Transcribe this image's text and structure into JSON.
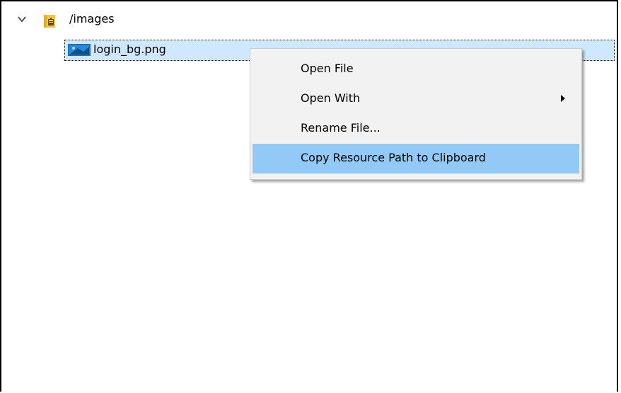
{
  "tree": {
    "folder": {
      "label": "/images",
      "expanded": true,
      "icon": "package-folder-icon"
    },
    "file": {
      "label": "login_bg.png",
      "icon": "image-file-icon",
      "selected": true
    }
  },
  "context_menu": {
    "items": [
      {
        "label": "Open File"
      },
      {
        "label": "Open With",
        "submenu": true
      },
      {
        "label": "Rename File..."
      },
      {
        "label": "Copy Resource Path to Clipboard",
        "highlighted": true
      }
    ]
  },
  "colors": {
    "selection": "#cde8ff",
    "menu_bg": "#f2f2f2",
    "menu_highlight": "#91c9f7",
    "folder_yellow": "#f5c542",
    "image_blue": "#1f6fb8"
  }
}
